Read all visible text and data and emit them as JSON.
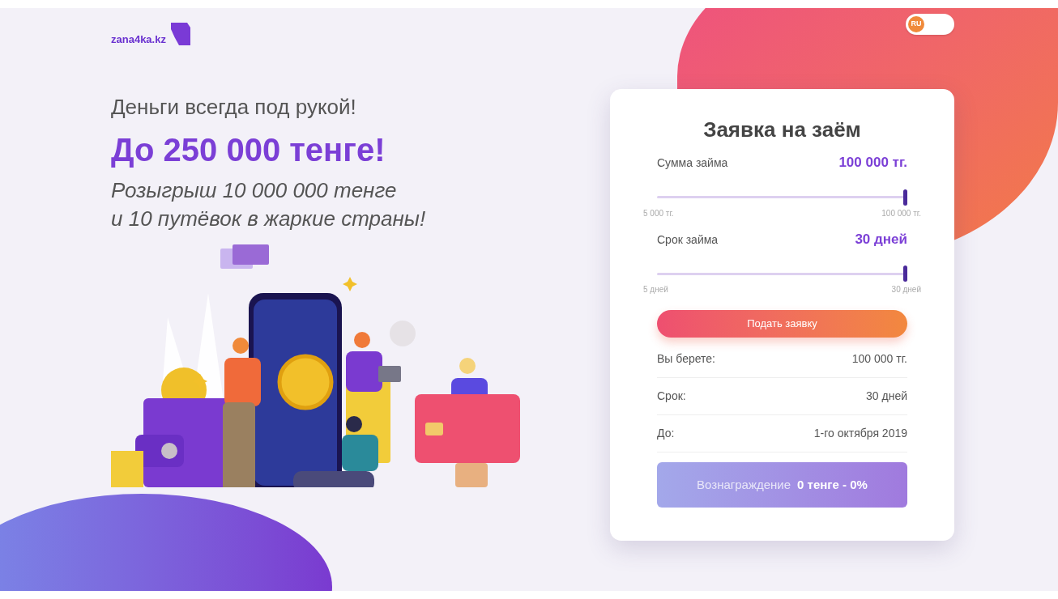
{
  "logo": {
    "text": "zana4ka.kz"
  },
  "language_toggle": {
    "label": "RU",
    "on": false
  },
  "hero": {
    "tagline": "Деньги всегда под рукой!",
    "headline": "До 250 000 тенге!",
    "promo_lines": [
      "Розыгрыш 10 000 000 тенге",
      "и 10 путёвок в жаркие страны!"
    ]
  },
  "loan_form": {
    "title": "Заявка на заём",
    "sliders": [
      {
        "label": "Сумма займа",
        "value": "100 000 тг.",
        "level": 1,
        "min": "5 000 тг.",
        "max": "100 000 тг."
      },
      {
        "label": "Срок займа",
        "value": "30 дней",
        "level": 1,
        "min": "5 дней",
        "max": "30 дней"
      }
    ],
    "submit_button": "Подать заявку",
    "summary": [
      {
        "label": "Вы берете:",
        "value": "100 000 тг."
      },
      {
        "label": "Срок:",
        "value": "30 дней"
      },
      {
        "label": "До:",
        "value": "1-го октября 2019"
      }
    ],
    "reward": {
      "label": "Вознаграждение",
      "value": "0 тенге - 0%"
    }
  }
}
